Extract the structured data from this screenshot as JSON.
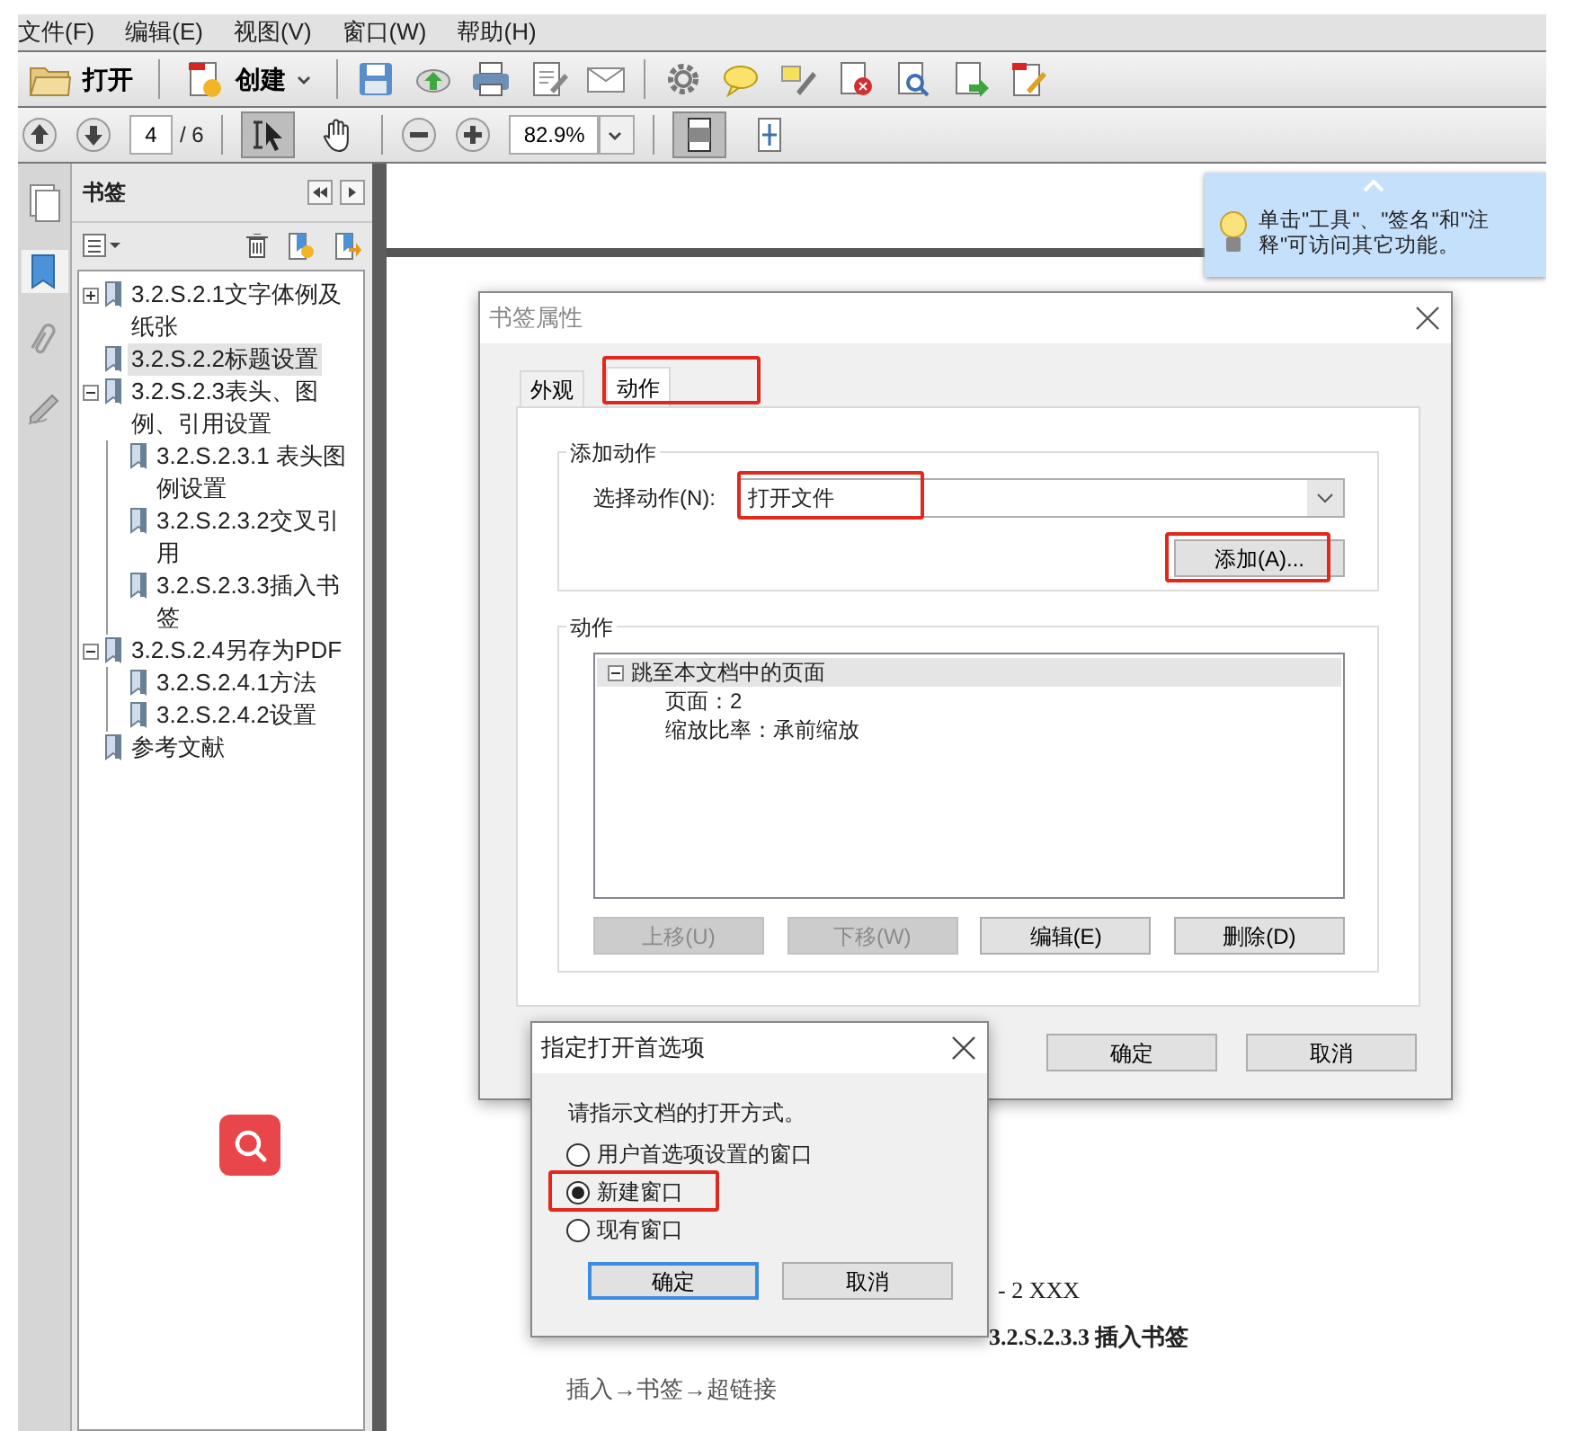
{
  "menu": [
    "文件(F)",
    "编辑(E)",
    "视图(V)",
    "窗口(W)",
    "帮助(H)"
  ],
  "toolbar": {
    "open": "打开",
    "create": "创建"
  },
  "navigation": {
    "page": "4",
    "page_count": "/ 6",
    "zoom": "82.9%",
    "select_tool": {
      "pressed": true
    },
    "hand_tool": {
      "pressed": false
    },
    "fit_page": {
      "pressed": true
    },
    "fit_width": {
      "pressed": false
    }
  },
  "side_tabs": [
    {
      "selected": false
    },
    {
      "selected": true
    },
    {
      "selected": false
    },
    {
      "selected": false
    }
  ],
  "bookmarks": {
    "title": "书签",
    "items": [
      {
        "label": "3.2.S.2.1文字体例及纸张",
        "kind": "folder",
        "expanded": false,
        "selected": false
      },
      {
        "label": "3.2.S.2.2标题设置",
        "kind": "leaf",
        "selected": true
      },
      {
        "label": "3.2.S.2.3表头、图例、引用设置",
        "kind": "folder",
        "expanded": true,
        "selected": false,
        "children": [
          {
            "label": "3.2.S.2.3.1 表头图例设置",
            "kind": "leaf",
            "selected": false
          },
          {
            "label": "3.2.S.2.3.2交叉引用",
            "kind": "leaf",
            "selected": false
          },
          {
            "label": "3.2.S.2.3.3插入书签",
            "kind": "leaf",
            "selected": false
          }
        ]
      },
      {
        "label": "3.2.S.2.4另存为PDF",
        "kind": "folder",
        "expanded": true,
        "selected": false,
        "children": [
          {
            "label": "3.2.S.2.4.1方法",
            "kind": "leaf",
            "selected": false
          },
          {
            "label": "3.2.S.2.4.2设置",
            "kind": "leaf",
            "selected": false
          }
        ]
      },
      {
        "label": "参考文献",
        "kind": "leaf",
        "selected": false
      }
    ]
  },
  "tip": {
    "text": "单击\"工具\"、\"签名\"和\"注释\"可访问其它功能。"
  },
  "document": {
    "lines": [
      {
        "kind": "tail",
        "text": "- 2 XXX"
      },
      {
        "kind": "heading",
        "text": "3.2.S.2.3.3 插入书签"
      },
      {
        "kind": "body",
        "text": "插入→书签→超链接"
      }
    ]
  },
  "bookmark_dialog": {
    "title": "书签属性",
    "tabs": [
      {
        "label": "外观",
        "selected": false,
        "highlighted": false
      },
      {
        "label": "动作",
        "selected": true,
        "highlighted": true
      }
    ],
    "add_group": {
      "title": "添加动作",
      "select_label": "选择动作(N):",
      "select_value": "打开文件",
      "select_highlighted": true,
      "add_button": "添加(A)...",
      "add_highlighted": true
    },
    "actions_group": {
      "title": "动作",
      "entries": [
        {
          "label": "跳至本文档中的页面",
          "expanded": true,
          "selected": true,
          "details": [
            "页面：2",
            "缩放比率：承前缩放"
          ]
        }
      ],
      "buttons": [
        {
          "label": "上移(U)",
          "disabled": true
        },
        {
          "label": "下移(W)",
          "disabled": true
        },
        {
          "label": "编辑(E)",
          "disabled": false
        },
        {
          "label": "删除(D)",
          "disabled": false
        }
      ]
    },
    "buttons": [
      "确定",
      "取消"
    ]
  },
  "open_dialog": {
    "title": "指定打开首选项",
    "prompt": "请指示文档的打开方式。",
    "options": [
      {
        "label": "用户首选项设置的窗口",
        "selected": false,
        "highlighted": false
      },
      {
        "label": "新建窗口",
        "selected": true,
        "highlighted": true
      },
      {
        "label": "现有窗口",
        "selected": false,
        "highlighted": false
      }
    ],
    "buttons": [
      {
        "label": "确定",
        "default": true
      },
      {
        "label": "取消",
        "default": false
      }
    ]
  }
}
